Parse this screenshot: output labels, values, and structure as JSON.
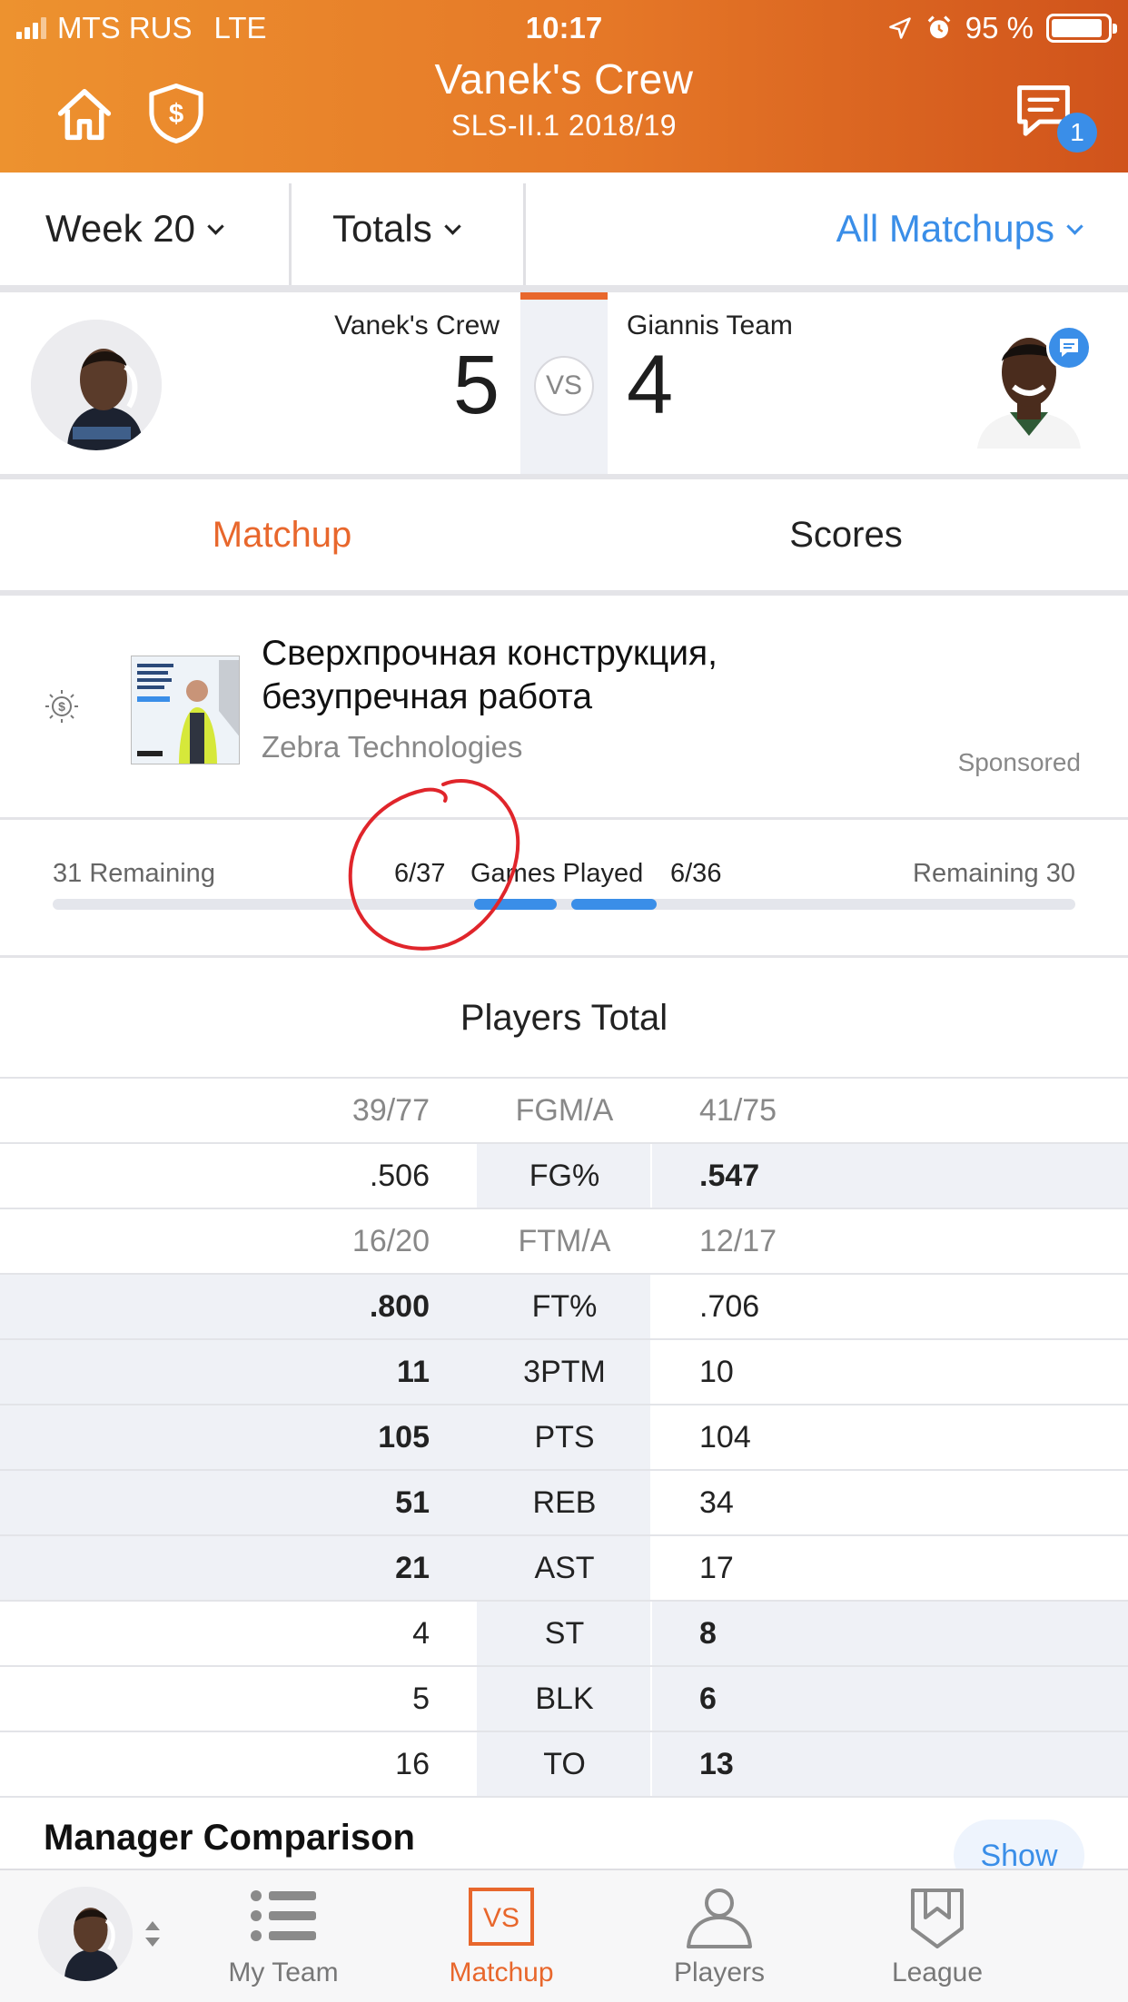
{
  "status_bar": {
    "carrier": "MTS RUS",
    "network": "LTE",
    "time": "10:17",
    "battery": "95 %"
  },
  "header": {
    "title": "Vanek's Crew",
    "subtitle": "SLS-II.1 2018/19",
    "messages_badge": "1",
    "accent_color": "#e8672c"
  },
  "filters": {
    "week": "Week 20",
    "view": "Totals",
    "matchups": "All Matchups"
  },
  "matchup": {
    "home": {
      "name": "Vanek's Crew",
      "score": "5"
    },
    "vs": "VS",
    "away": {
      "name": "Giannis Team",
      "score": "4"
    }
  },
  "tabs": [
    {
      "label": "Matchup"
    },
    {
      "label": "Scores"
    }
  ],
  "ad": {
    "headline": "Сверхпрочная конструкция, безупречная работа",
    "advertiser": "Zebra Technologies",
    "sponsored": "Sponsored"
  },
  "games_played": {
    "left_remaining": "31 Remaining",
    "left_count": "6/37",
    "label": "Games Played",
    "right_count": "6/36",
    "right_remaining": "Remaining 30",
    "left_progress": 0.162,
    "right_progress": 0.167
  },
  "players_total": {
    "title": "Players Total",
    "rows": [
      {
        "left": "39/77",
        "cat": "FGM/A",
        "right": "41/75",
        "muted": true,
        "winner": ""
      },
      {
        "left": ".506",
        "cat": "FG%",
        "right": ".547",
        "muted": false,
        "winner": "right"
      },
      {
        "left": "16/20",
        "cat": "FTM/A",
        "right": "12/17",
        "muted": true,
        "winner": ""
      },
      {
        "left": ".800",
        "cat": "FT%",
        "right": ".706",
        "muted": false,
        "winner": "left"
      },
      {
        "left": "11",
        "cat": "3PTM",
        "right": "10",
        "muted": false,
        "winner": "left"
      },
      {
        "left": "105",
        "cat": "PTS",
        "right": "104",
        "muted": false,
        "winner": "left"
      },
      {
        "left": "51",
        "cat": "REB",
        "right": "34",
        "muted": false,
        "winner": "left"
      },
      {
        "left": "21",
        "cat": "AST",
        "right": "17",
        "muted": false,
        "winner": "left"
      },
      {
        "left": "4",
        "cat": "ST",
        "right": "8",
        "muted": false,
        "winner": "right"
      },
      {
        "left": "5",
        "cat": "BLK",
        "right": "6",
        "muted": false,
        "winner": "right"
      },
      {
        "left": "16",
        "cat": "TO",
        "right": "13",
        "muted": false,
        "winner": "right"
      }
    ]
  },
  "manager_comparison": {
    "title": "Manager Comparison",
    "button": "Show"
  },
  "bottom_nav": [
    {
      "label": "My Team",
      "icon": "list-icon"
    },
    {
      "label": "Matchup",
      "icon": "vs-icon"
    },
    {
      "label": "Players",
      "icon": "person-icon"
    },
    {
      "label": "League",
      "icon": "shield-icon"
    }
  ]
}
